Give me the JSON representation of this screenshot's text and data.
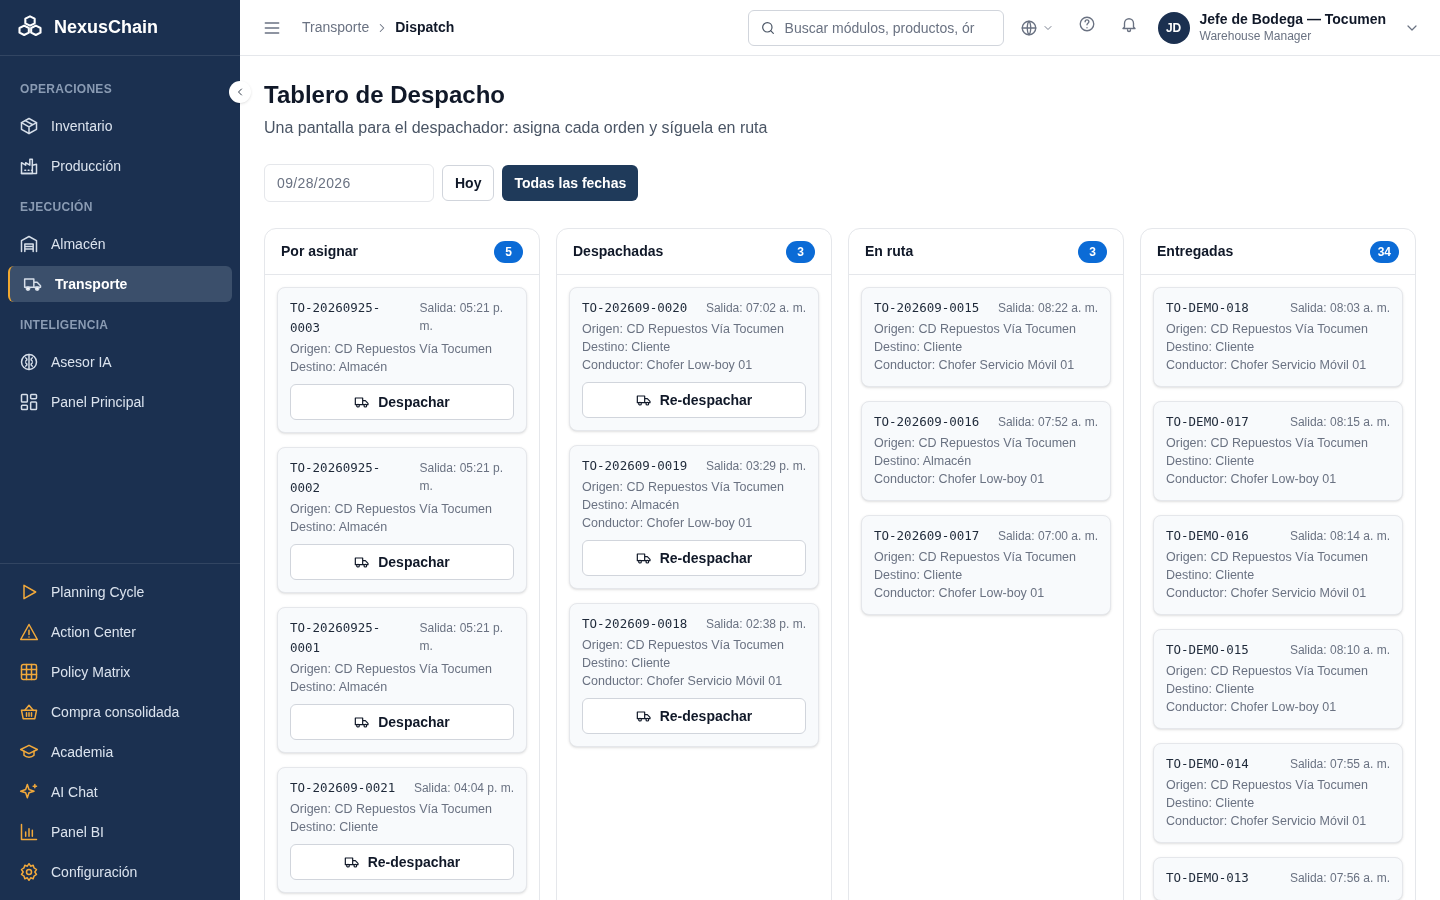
{
  "sidebar": {
    "brand": "NexusChain",
    "sections": [
      {
        "title": "OPERACIONES",
        "items": [
          {
            "label": "Inventario",
            "selected": false
          },
          {
            "label": "Producción",
            "selected": false
          }
        ]
      },
      {
        "title": "EJECUCIÓN",
        "items": [
          {
            "label": "Almacén",
            "selected": false
          },
          {
            "label": "Transporte",
            "selected": true
          }
        ]
      },
      {
        "title": "INTELIGENCIA",
        "items": [
          {
            "label": "Asesor IA",
            "selected": false
          },
          {
            "label": "Panel Principal",
            "selected": false
          }
        ]
      }
    ],
    "bottom_items": [
      {
        "label": "Planning Cycle"
      },
      {
        "label": "Action Center"
      },
      {
        "label": "Policy Matrix"
      },
      {
        "label": "Compra consolidada"
      },
      {
        "label": "Academia"
      },
      {
        "label": "AI Chat"
      },
      {
        "label": "Panel BI"
      },
      {
        "label": "Configuración"
      }
    ]
  },
  "header": {
    "breadcrumb": [
      "Transporte",
      "Dispatch"
    ],
    "search": {
      "placeholder": "Buscar módulos, productos, ór"
    },
    "user": {
      "initials": "JD",
      "name": "Jefe de Bodega — Tocumen",
      "role": "Warehouse Manager"
    }
  },
  "page": {
    "title": "Tablero de Despacho",
    "subtitle": "Una pantalla para el despachador: asigna cada orden y síguela en ruta",
    "date_field": {
      "value": "09/28/2026"
    },
    "filters": [
      {
        "label": "Hoy",
        "selected": false
      },
      {
        "label": "Todas las fechas",
        "selected": true
      }
    ]
  },
  "columns": [
    {
      "title": "Por asignar",
      "count": "5",
      "cards": [
        {
          "id": "TO-20260925-0003",
          "departure": "Salida: 05:21 p. m.",
          "lines": [
            "Origen: CD Repuestos Vía Tocumen",
            "Destino: Almacén"
          ],
          "action": "Despachar"
        },
        {
          "id": "TO-20260925-0002",
          "departure": "Salida: 05:21 p. m.",
          "lines": [
            "Origen: CD Repuestos Vía Tocumen",
            "Destino: Almacén"
          ],
          "action": "Despachar"
        },
        {
          "id": "TO-20260925-0001",
          "departure": "Salida: 05:21 p. m.",
          "lines": [
            "Origen: CD Repuestos Vía Tocumen",
            "Destino: Almacén"
          ],
          "action": "Despachar"
        },
        {
          "id": "TO-202609-0021",
          "departure": "Salida: 04:04 p. m.",
          "lines": [
            "Origen: CD Repuestos Vía Tocumen",
            "Destino: Cliente"
          ],
          "action": "Re-despachar"
        }
      ]
    },
    {
      "title": "Despachadas",
      "count": "3",
      "cards": [
        {
          "id": "TO-202609-0020",
          "departure": "Salida: 07:02 a. m.",
          "lines": [
            "Origen: CD Repuestos Vía Tocumen",
            "Destino: Cliente",
            "Conductor: Chofer Low-boy 01"
          ],
          "action": "Re-despachar"
        },
        {
          "id": "TO-202609-0019",
          "departure": "Salida: 03:29 p. m.",
          "lines": [
            "Origen: CD Repuestos Vía Tocumen",
            "Destino: Almacén",
            "Conductor: Chofer Low-boy 01"
          ],
          "action": "Re-despachar"
        },
        {
          "id": "TO-202609-0018",
          "departure": "Salida: 02:38 p. m.",
          "lines": [
            "Origen: CD Repuestos Vía Tocumen",
            "Destino: Cliente",
            "Conductor: Chofer Servicio Móvil 01"
          ],
          "action": "Re-despachar"
        }
      ]
    },
    {
      "title": "En ruta",
      "count": "3",
      "cards": [
        {
          "id": "TO-202609-0015",
          "departure": "Salida: 08:22 a. m.",
          "lines": [
            "Origen: CD Repuestos Vía Tocumen",
            "Destino: Cliente",
            "Conductor: Chofer Servicio Móvil 01"
          ]
        },
        {
          "id": "TO-202609-0016",
          "departure": "Salida: 07:52 a. m.",
          "lines": [
            "Origen: CD Repuestos Vía Tocumen",
            "Destino: Almacén",
            "Conductor: Chofer Low-boy 01"
          ]
        },
        {
          "id": "TO-202609-0017",
          "departure": "Salida: 07:00 a. m.",
          "lines": [
            "Origen: CD Repuestos Vía Tocumen",
            "Destino: Cliente",
            "Conductor: Chofer Low-boy 01"
          ]
        }
      ]
    },
    {
      "title": "Entregadas",
      "count": "34",
      "cards": [
        {
          "id": "TO-DEMO-018",
          "departure": "Salida: 08:03 a. m.",
          "lines": [
            "Origen: CD Repuestos Vía Tocumen",
            "Destino: Cliente",
            "Conductor: Chofer Servicio Móvil 01"
          ]
        },
        {
          "id": "TO-DEMO-017",
          "departure": "Salida: 08:15 a. m.",
          "lines": [
            "Origen: CD Repuestos Vía Tocumen",
            "Destino: Cliente",
            "Conductor: Chofer Low-boy 01"
          ]
        },
        {
          "id": "TO-DEMO-016",
          "departure": "Salida: 08:14 a. m.",
          "lines": [
            "Origen: CD Repuestos Vía Tocumen",
            "Destino: Cliente",
            "Conductor: Chofer Servicio Móvil 01"
          ]
        },
        {
          "id": "TO-DEMO-015",
          "departure": "Salida: 08:10 a. m.",
          "lines": [
            "Origen: CD Repuestos Vía Tocumen",
            "Destino: Cliente",
            "Conductor: Chofer Low-boy 01"
          ]
        },
        {
          "id": "TO-DEMO-014",
          "departure": "Salida: 07:55 a. m.",
          "lines": [
            "Origen: CD Repuestos Vía Tocumen",
            "Destino: Cliente",
            "Conductor: Chofer Servicio Móvil 01"
          ]
        },
        {
          "id": "TO-DEMO-013",
          "departure": "Salida: 07:56 a. m."
        }
      ]
    }
  ]
}
